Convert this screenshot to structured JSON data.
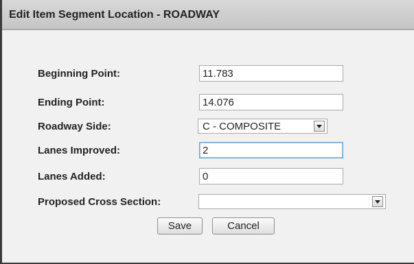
{
  "dialog": {
    "title": "Edit Item Segment Location - ROADWAY"
  },
  "form": {
    "beginning_point": {
      "label": "Beginning Point:",
      "value": "11.783"
    },
    "ending_point": {
      "label": "Ending Point:",
      "value": "14.076"
    },
    "roadway_side": {
      "label": "Roadway Side:",
      "value": "C - COMPOSITE"
    },
    "lanes_improved": {
      "label": "Lanes Improved:",
      "value": "2"
    },
    "lanes_added": {
      "label": "Lanes Added:",
      "value": "0"
    },
    "proposed_cross_section": {
      "label": "Proposed Cross Section:",
      "value": ""
    }
  },
  "buttons": {
    "save_label": "Save",
    "cancel_label": "Cancel"
  },
  "icons": {
    "dropdown": "chevron-down-icon"
  },
  "colors": {
    "titlebar": "#c6c5c5",
    "background": "#f2f1f1",
    "focus_border": "#6aa3d6"
  }
}
